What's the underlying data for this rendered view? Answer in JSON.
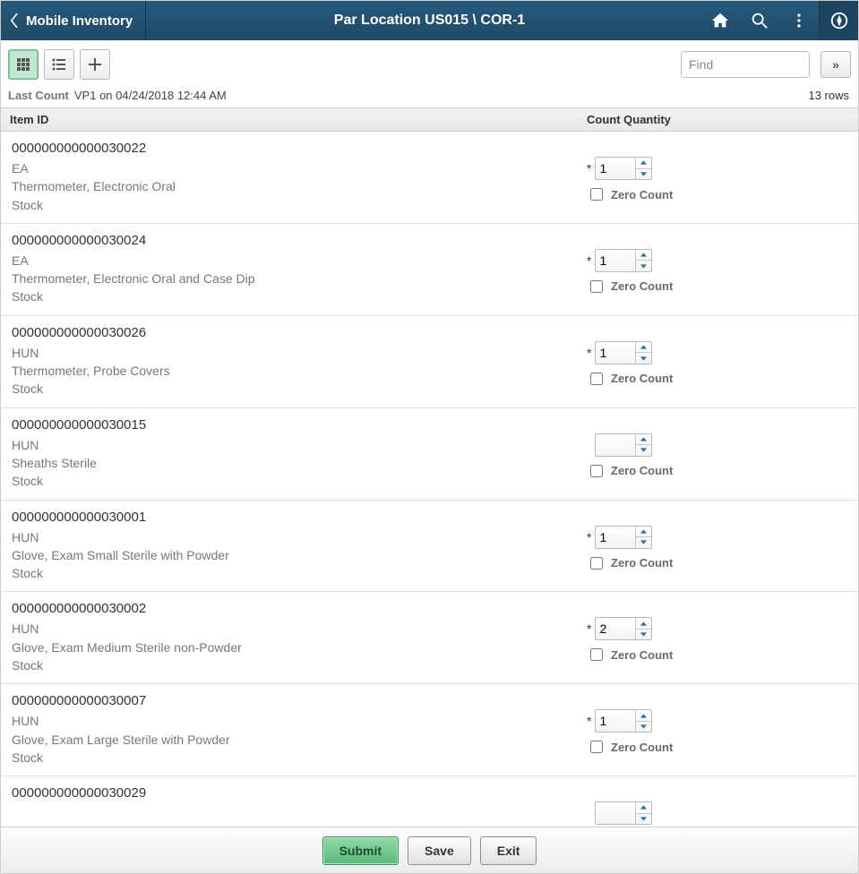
{
  "header": {
    "back_label": "Mobile Inventory",
    "title": "Par Location US015 \\ COR-1"
  },
  "toolbar": {
    "find_placeholder": "Find"
  },
  "last_count": {
    "label": "Last Count",
    "value": "VP1 on 04/24/2018 12:44 AM",
    "rows_label": "13 rows"
  },
  "columns": {
    "item_id": "Item ID",
    "count_qty": "Count Quantity"
  },
  "zero_count_label": "Zero Count",
  "items": [
    {
      "id": "000000000000030022",
      "uom": "EA",
      "desc": "Thermometer, Electronic Oral",
      "stock": "Stock",
      "qty": "1",
      "required": true
    },
    {
      "id": "000000000000030024",
      "uom": "EA",
      "desc": "Thermometer, Electronic Oral and Case Dip",
      "stock": "Stock",
      "qty": "1",
      "required": true
    },
    {
      "id": "000000000000030026",
      "uom": "HUN",
      "desc": "Thermometer, Probe Covers",
      "stock": "Stock",
      "qty": "1",
      "required": true
    },
    {
      "id": "000000000000030015",
      "uom": "HUN",
      "desc": "Sheaths Sterile",
      "stock": "Stock",
      "qty": "",
      "required": false
    },
    {
      "id": "000000000000030001",
      "uom": "HUN",
      "desc": "Glove, Exam Small Sterile with Powder",
      "stock": "Stock",
      "qty": "1",
      "required": true
    },
    {
      "id": "000000000000030002",
      "uom": "HUN",
      "desc": "Glove, Exam Medium Sterile non-Powder",
      "stock": "Stock",
      "qty": "2",
      "required": true
    },
    {
      "id": "000000000000030007",
      "uom": "HUN",
      "desc": "Glove, Exam Large Sterile with Powder",
      "stock": "Stock",
      "qty": "1",
      "required": true
    },
    {
      "id": "000000000000030029",
      "uom": "",
      "desc": "",
      "stock": "",
      "qty": "",
      "required": false
    }
  ],
  "footer": {
    "submit": "Submit",
    "save": "Save",
    "exit": "Exit"
  }
}
